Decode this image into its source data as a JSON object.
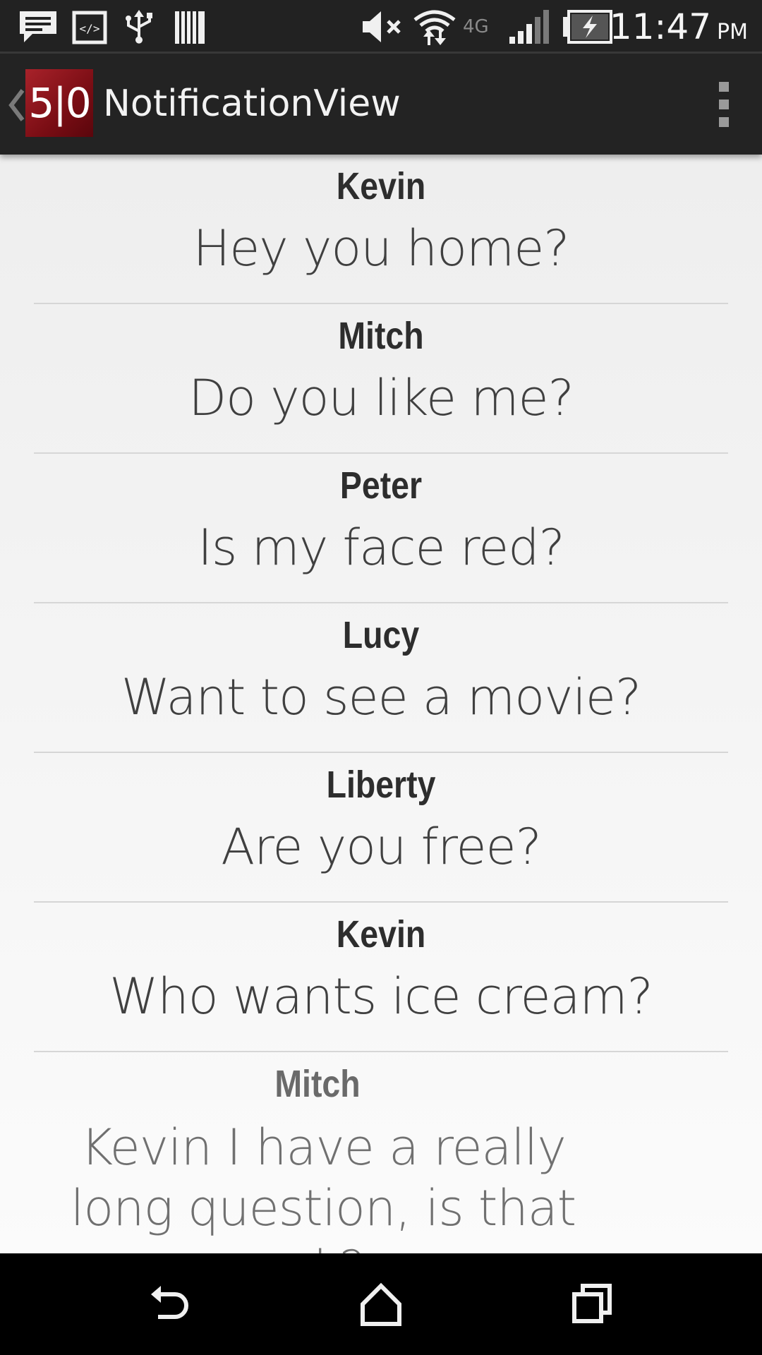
{
  "status_bar": {
    "time": "11:47",
    "ampm": "PM",
    "network_label": "4G",
    "icons": [
      "message-icon",
      "code-icon",
      "usb-icon",
      "storage-icon",
      "mute-icon",
      "wifi-icon",
      "signal-icon",
      "battery-charging-icon"
    ]
  },
  "action_bar": {
    "logo_text": "5|0",
    "title": "NotificationView"
  },
  "notifications": [
    {
      "sender": "Kevin",
      "message": "Hey you home?"
    },
    {
      "sender": "Mitch",
      "message": "Do you like me?"
    },
    {
      "sender": "Peter",
      "message": "Is my face red?"
    },
    {
      "sender": "Lucy",
      "message": "Want to see a movie?"
    },
    {
      "sender": "Liberty",
      "message": "Are you free?"
    },
    {
      "sender": "Kevin",
      "message": "Who wants ice cream?"
    },
    {
      "sender": "Mitch",
      "message": "Kevin I have a really long question, is that ok?"
    }
  ],
  "nav_bar": {
    "icons": [
      "back-icon",
      "home-icon",
      "recents-icon"
    ]
  }
}
